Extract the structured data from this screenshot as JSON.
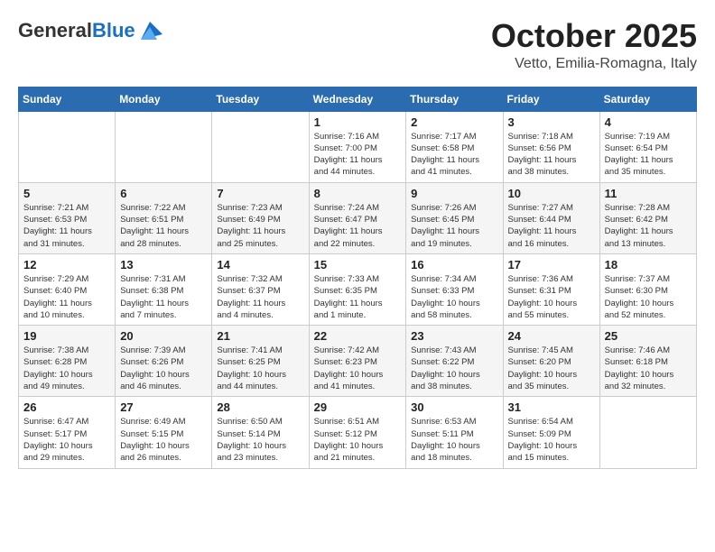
{
  "logo": {
    "general": "General",
    "blue": "Blue"
  },
  "header": {
    "month": "October 2025",
    "location": "Vetto, Emilia-Romagna, Italy"
  },
  "weekdays": [
    "Sunday",
    "Monday",
    "Tuesday",
    "Wednesday",
    "Thursday",
    "Friday",
    "Saturday"
  ],
  "weeks": [
    [
      {
        "day": "",
        "info": ""
      },
      {
        "day": "",
        "info": ""
      },
      {
        "day": "",
        "info": ""
      },
      {
        "day": "1",
        "info": "Sunrise: 7:16 AM\nSunset: 7:00 PM\nDaylight: 11 hours\nand 44 minutes."
      },
      {
        "day": "2",
        "info": "Sunrise: 7:17 AM\nSunset: 6:58 PM\nDaylight: 11 hours\nand 41 minutes."
      },
      {
        "day": "3",
        "info": "Sunrise: 7:18 AM\nSunset: 6:56 PM\nDaylight: 11 hours\nand 38 minutes."
      },
      {
        "day": "4",
        "info": "Sunrise: 7:19 AM\nSunset: 6:54 PM\nDaylight: 11 hours\nand 35 minutes."
      }
    ],
    [
      {
        "day": "5",
        "info": "Sunrise: 7:21 AM\nSunset: 6:53 PM\nDaylight: 11 hours\nand 31 minutes."
      },
      {
        "day": "6",
        "info": "Sunrise: 7:22 AM\nSunset: 6:51 PM\nDaylight: 11 hours\nand 28 minutes."
      },
      {
        "day": "7",
        "info": "Sunrise: 7:23 AM\nSunset: 6:49 PM\nDaylight: 11 hours\nand 25 minutes."
      },
      {
        "day": "8",
        "info": "Sunrise: 7:24 AM\nSunset: 6:47 PM\nDaylight: 11 hours\nand 22 minutes."
      },
      {
        "day": "9",
        "info": "Sunrise: 7:26 AM\nSunset: 6:45 PM\nDaylight: 11 hours\nand 19 minutes."
      },
      {
        "day": "10",
        "info": "Sunrise: 7:27 AM\nSunset: 6:44 PM\nDaylight: 11 hours\nand 16 minutes."
      },
      {
        "day": "11",
        "info": "Sunrise: 7:28 AM\nSunset: 6:42 PM\nDaylight: 11 hours\nand 13 minutes."
      }
    ],
    [
      {
        "day": "12",
        "info": "Sunrise: 7:29 AM\nSunset: 6:40 PM\nDaylight: 11 hours\nand 10 minutes."
      },
      {
        "day": "13",
        "info": "Sunrise: 7:31 AM\nSunset: 6:38 PM\nDaylight: 11 hours\nand 7 minutes."
      },
      {
        "day": "14",
        "info": "Sunrise: 7:32 AM\nSunset: 6:37 PM\nDaylight: 11 hours\nand 4 minutes."
      },
      {
        "day": "15",
        "info": "Sunrise: 7:33 AM\nSunset: 6:35 PM\nDaylight: 11 hours\nand 1 minute."
      },
      {
        "day": "16",
        "info": "Sunrise: 7:34 AM\nSunset: 6:33 PM\nDaylight: 10 hours\nand 58 minutes."
      },
      {
        "day": "17",
        "info": "Sunrise: 7:36 AM\nSunset: 6:31 PM\nDaylight: 10 hours\nand 55 minutes."
      },
      {
        "day": "18",
        "info": "Sunrise: 7:37 AM\nSunset: 6:30 PM\nDaylight: 10 hours\nand 52 minutes."
      }
    ],
    [
      {
        "day": "19",
        "info": "Sunrise: 7:38 AM\nSunset: 6:28 PM\nDaylight: 10 hours\nand 49 minutes."
      },
      {
        "day": "20",
        "info": "Sunrise: 7:39 AM\nSunset: 6:26 PM\nDaylight: 10 hours\nand 46 minutes."
      },
      {
        "day": "21",
        "info": "Sunrise: 7:41 AM\nSunset: 6:25 PM\nDaylight: 10 hours\nand 44 minutes."
      },
      {
        "day": "22",
        "info": "Sunrise: 7:42 AM\nSunset: 6:23 PM\nDaylight: 10 hours\nand 41 minutes."
      },
      {
        "day": "23",
        "info": "Sunrise: 7:43 AM\nSunset: 6:22 PM\nDaylight: 10 hours\nand 38 minutes."
      },
      {
        "day": "24",
        "info": "Sunrise: 7:45 AM\nSunset: 6:20 PM\nDaylight: 10 hours\nand 35 minutes."
      },
      {
        "day": "25",
        "info": "Sunrise: 7:46 AM\nSunset: 6:18 PM\nDaylight: 10 hours\nand 32 minutes."
      }
    ],
    [
      {
        "day": "26",
        "info": "Sunrise: 6:47 AM\nSunset: 5:17 PM\nDaylight: 10 hours\nand 29 minutes."
      },
      {
        "day": "27",
        "info": "Sunrise: 6:49 AM\nSunset: 5:15 PM\nDaylight: 10 hours\nand 26 minutes."
      },
      {
        "day": "28",
        "info": "Sunrise: 6:50 AM\nSunset: 5:14 PM\nDaylight: 10 hours\nand 23 minutes."
      },
      {
        "day": "29",
        "info": "Sunrise: 6:51 AM\nSunset: 5:12 PM\nDaylight: 10 hours\nand 21 minutes."
      },
      {
        "day": "30",
        "info": "Sunrise: 6:53 AM\nSunset: 5:11 PM\nDaylight: 10 hours\nand 18 minutes."
      },
      {
        "day": "31",
        "info": "Sunrise: 6:54 AM\nSunset: 5:09 PM\nDaylight: 10 hours\nand 15 minutes."
      },
      {
        "day": "",
        "info": ""
      }
    ]
  ]
}
